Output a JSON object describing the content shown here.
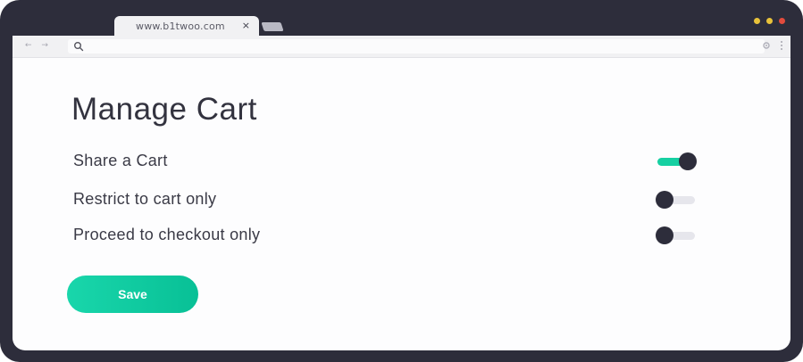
{
  "browser": {
    "tab_url": "www.b1twoo.com",
    "tab_close": "×",
    "nav_arrows": "← →",
    "window_dot_colors": [
      "#e8c23a",
      "#e8c23a",
      "#e24b3d"
    ]
  },
  "icons": {
    "search": "search-icon",
    "extension": "gear-icon",
    "menu": "kebab-menu-icon",
    "close": "close-icon"
  },
  "page": {
    "title": "Manage Cart",
    "settings": [
      {
        "label": "Share a Cart",
        "enabled": true
      },
      {
        "label": "Restrict to cart only",
        "enabled": false
      },
      {
        "label": "Proceed to checkout only",
        "enabled": false
      }
    ],
    "save_label": "Save"
  },
  "colors": {
    "accent": "#16d0a2",
    "frame": "#2d2d3b",
    "toggle_off_track": "#e6e6ec"
  }
}
